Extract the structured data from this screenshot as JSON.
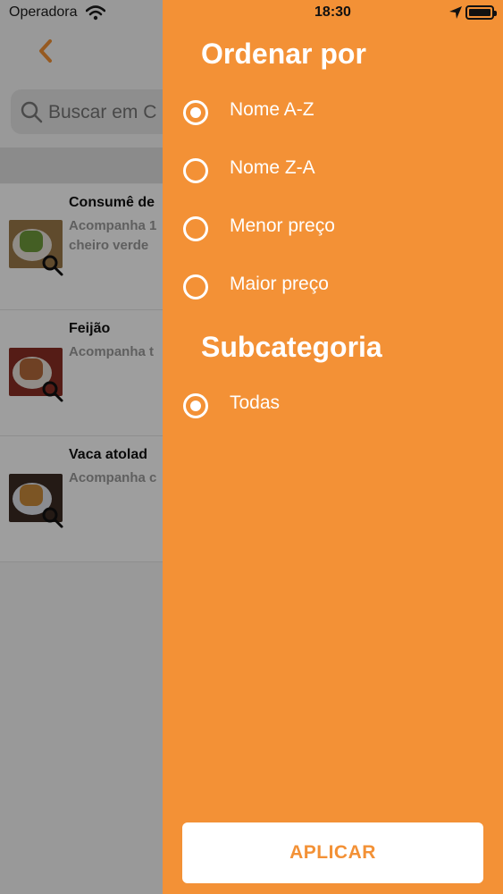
{
  "status": {
    "carrier": "Operadora",
    "time": "18:30"
  },
  "search": {
    "placeholder": "Buscar em C"
  },
  "items": [
    {
      "title": "Consumê de",
      "desc": "Acompanha 1 cheiro verde"
    },
    {
      "title": "Feijão",
      "desc": "Acompanha t"
    },
    {
      "title": "Vaca atolad",
      "desc": "Acompanha c"
    }
  ],
  "drawer": {
    "sort_title": "Ordenar por",
    "sort_options": [
      "Nome A-Z",
      "Nome Z-A",
      "Menor preço",
      "Maior preço"
    ],
    "sub_title": "Subcategoria",
    "sub_options": [
      "Todas"
    ],
    "apply_label": "APLICAR"
  },
  "colors": {
    "accent": "#f39136",
    "dim": "rgba(0,0,0,0.38)"
  }
}
